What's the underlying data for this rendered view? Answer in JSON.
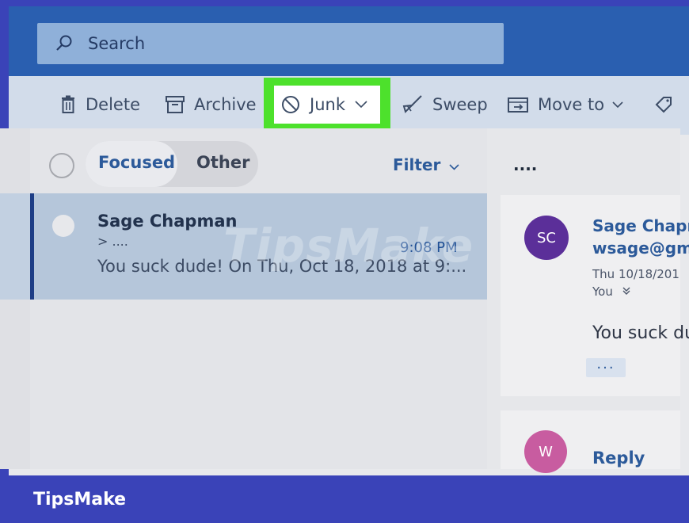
{
  "search": {
    "placeholder": "Search"
  },
  "toolbar": {
    "delete": "Delete",
    "archive": "Archive",
    "junk": "Junk",
    "sweep": "Sweep",
    "move_to": "Move to"
  },
  "list": {
    "tabs": [
      "Focused",
      "Other"
    ],
    "filter": "Filter",
    "items": [
      {
        "sender": "Sage Chapman",
        "subject": "> ....",
        "time": "9:08 PM",
        "preview": "You suck dude! On Thu, Oct 18, 2018 at 9:..."
      }
    ]
  },
  "reading": {
    "header_dots": "....",
    "sender_initials": "SC",
    "sender_name": "Sage Chapm",
    "sender_email": "wsage@gm",
    "date": "Thu 10/18/201",
    "to": "You",
    "body": "You suck du",
    "more": "...",
    "reply_initial": "W",
    "reply": "Reply"
  },
  "watermark": "TipsMake",
  "footer": {
    "brand": "TipsMake"
  },
  "colors": {
    "frame": "#3a43b8",
    "topbar": "#2a5fb0",
    "highlight": "#4de12c",
    "avatar_sc": "#5b2f99",
    "avatar_w": "#c85ca0",
    "accent": "#2c5a9a"
  }
}
